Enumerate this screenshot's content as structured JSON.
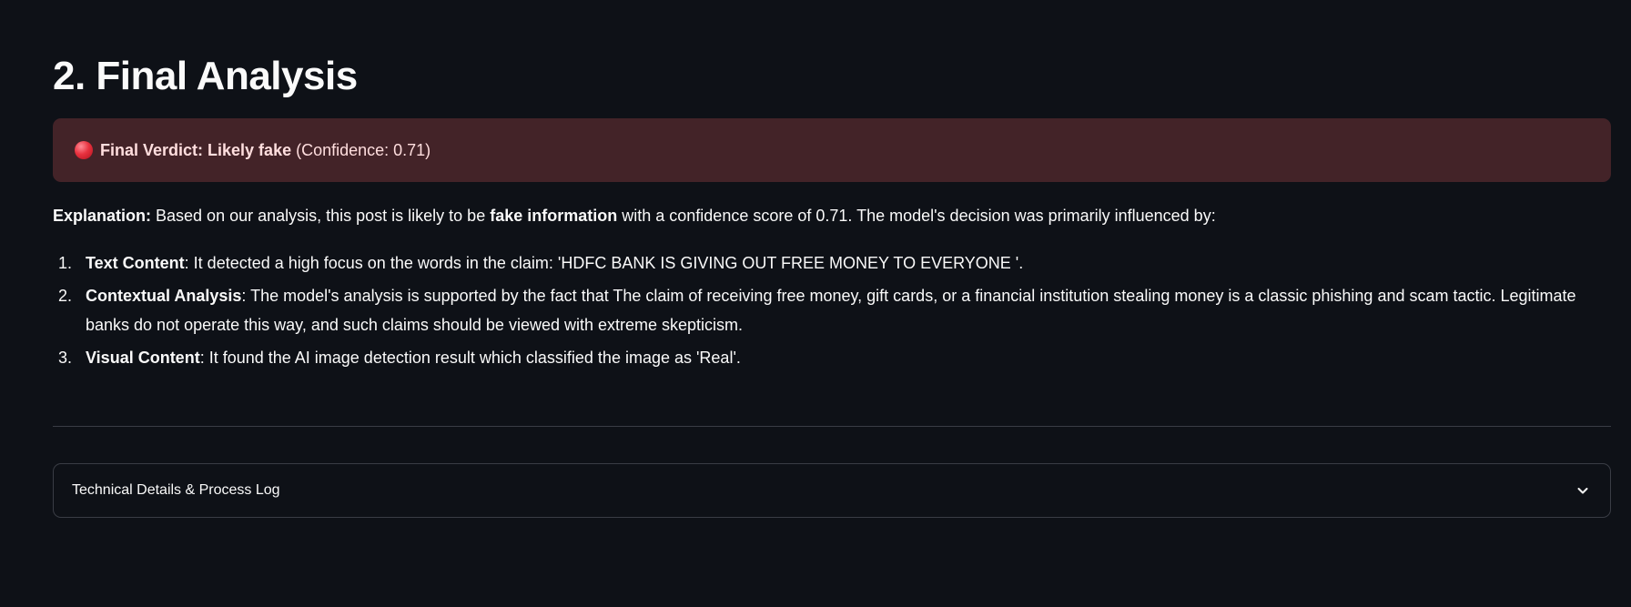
{
  "page_title": "2. Final Analysis",
  "verdict": {
    "label": "Final Verdict: Likely fake",
    "confidence": "(Confidence: 0.71)",
    "icon": "red-circle-icon",
    "background_color": "#432328"
  },
  "explanation": {
    "lead": "Explanation:",
    "part1": " Based on our analysis, this post is likely to be ",
    "emphasis": "fake information",
    "part2": " with a confidence score of 0.71. The model's decision was primarily influenced by:"
  },
  "reasons": [
    {
      "number": "1.",
      "title": "Text Content",
      "text": ": It detected a high focus on the words in the claim: 'HDFC BANK IS GIVING OUT FREE MONEY TO EVERYONE '."
    },
    {
      "number": "2.",
      "title": "Contextual Analysis",
      "text": ": The model's analysis is supported by the fact that The claim of receiving free money, gift cards, or a financial institution stealing money is a classic phishing and scam tactic. Legitimate banks do not operate this way, and such claims should be viewed with extreme skepticism."
    },
    {
      "number": "3.",
      "title": "Visual Content",
      "text": ": It found the AI image detection result which classified the image as 'Real'."
    }
  ],
  "expander": {
    "label": "Technical Details & Process Log",
    "icon": "chevron-down-icon"
  }
}
